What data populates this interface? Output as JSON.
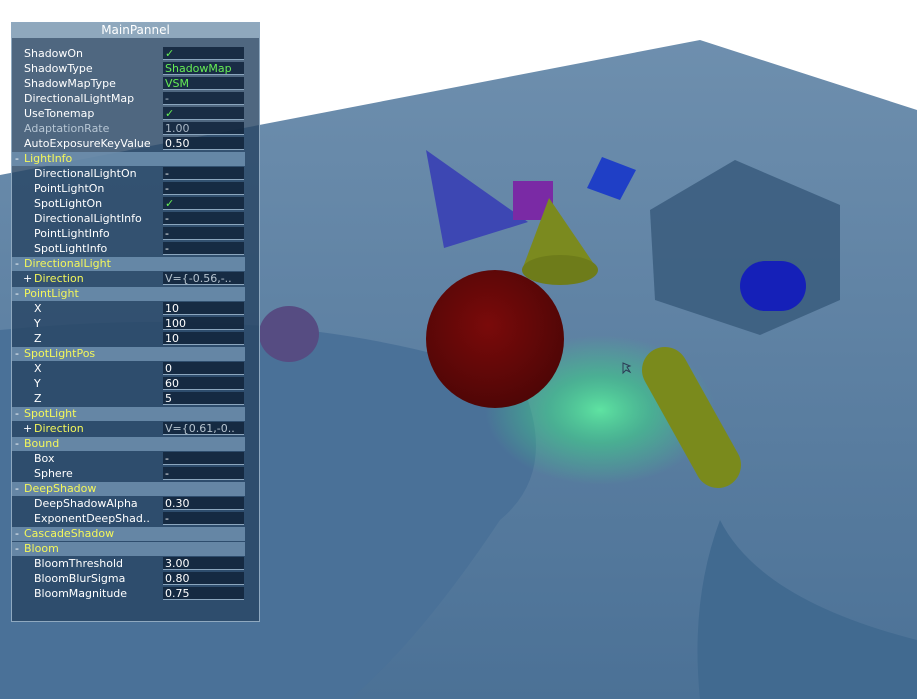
{
  "panel": {
    "title": "MainPannel",
    "rows": [
      {
        "kind": "prop",
        "label": "ShadowOn",
        "value": "✓",
        "style": "green"
      },
      {
        "kind": "prop",
        "label": "ShadowType",
        "value": "ShadowMap",
        "style": "green"
      },
      {
        "kind": "prop",
        "label": "ShadowMapType",
        "value": "VSM",
        "style": "green"
      },
      {
        "kind": "prop",
        "label": "DirectionalLightMap",
        "value": "-",
        "style": "gray"
      },
      {
        "kind": "prop",
        "label": "UseTonemap",
        "value": "✓",
        "style": "green"
      },
      {
        "kind": "prop",
        "label": "AdaptationRate",
        "value": "1.00",
        "style": "dimv",
        "dim": true
      },
      {
        "kind": "prop",
        "label": "AutoExposureKeyValue",
        "value": "0.50"
      },
      {
        "kind": "cat",
        "label": "LightInfo",
        "toggle": "-"
      },
      {
        "kind": "sub",
        "label": "DirectionalLightOn",
        "value": "-"
      },
      {
        "kind": "sub",
        "label": "PointLightOn",
        "value": "-"
      },
      {
        "kind": "sub",
        "label": "SpotLightOn",
        "value": "✓",
        "style": "green"
      },
      {
        "kind": "sub",
        "label": "DirectionalLightInfo",
        "value": "-"
      },
      {
        "kind": "sub",
        "label": "PointLightInfo",
        "value": "-"
      },
      {
        "kind": "sub",
        "label": "SpotLightInfo",
        "value": "-"
      },
      {
        "kind": "cat",
        "label": "DirectionalLight",
        "toggle": "-"
      },
      {
        "kind": "group",
        "label": "Direction",
        "toggle": "+",
        "value": "V={-0.56,-..",
        "style": "gray"
      },
      {
        "kind": "cat",
        "label": "PointLight",
        "toggle": "-"
      },
      {
        "kind": "sub",
        "label": "X",
        "value": "10"
      },
      {
        "kind": "sub",
        "label": "Y",
        "value": "100"
      },
      {
        "kind": "sub",
        "label": "Z",
        "value": "10"
      },
      {
        "kind": "cat",
        "label": "SpotLightPos",
        "toggle": "-"
      },
      {
        "kind": "sub",
        "label": "X",
        "value": "0"
      },
      {
        "kind": "sub",
        "label": "Y",
        "value": "60"
      },
      {
        "kind": "sub",
        "label": "Z",
        "value": "5"
      },
      {
        "kind": "cat",
        "label": "SpotLight",
        "toggle": "-"
      },
      {
        "kind": "group",
        "label": "Direction",
        "toggle": "+",
        "value": "V={0.61,-0..",
        "style": "gray"
      },
      {
        "kind": "cat",
        "label": "Bound",
        "toggle": "-"
      },
      {
        "kind": "sub",
        "label": "Box",
        "value": "-"
      },
      {
        "kind": "sub",
        "label": "Sphere",
        "value": "-"
      },
      {
        "kind": "cat",
        "label": "DeepShadow",
        "toggle": "-"
      },
      {
        "kind": "sub",
        "label": "DeepShadowAlpha",
        "value": "0.30"
      },
      {
        "kind": "sub",
        "label": "ExponentDeepShad..",
        "value": "-"
      },
      {
        "kind": "cat",
        "label": "CascadeShadow",
        "toggle": "-"
      },
      {
        "kind": "cat",
        "label": "Bloom",
        "toggle": "-"
      },
      {
        "kind": "sub",
        "label": "BloomThreshold",
        "value": "3.00"
      },
      {
        "kind": "sub",
        "label": "BloomBlurSigma",
        "value": "0.80"
      },
      {
        "kind": "sub",
        "label": "BloomMagnitude",
        "value": "0.75"
      }
    ]
  },
  "colors": {
    "background": "#3d5f83",
    "floor": "#4a7399",
    "highlight_label": "#f4f75a",
    "check_green": "#66ee55"
  }
}
